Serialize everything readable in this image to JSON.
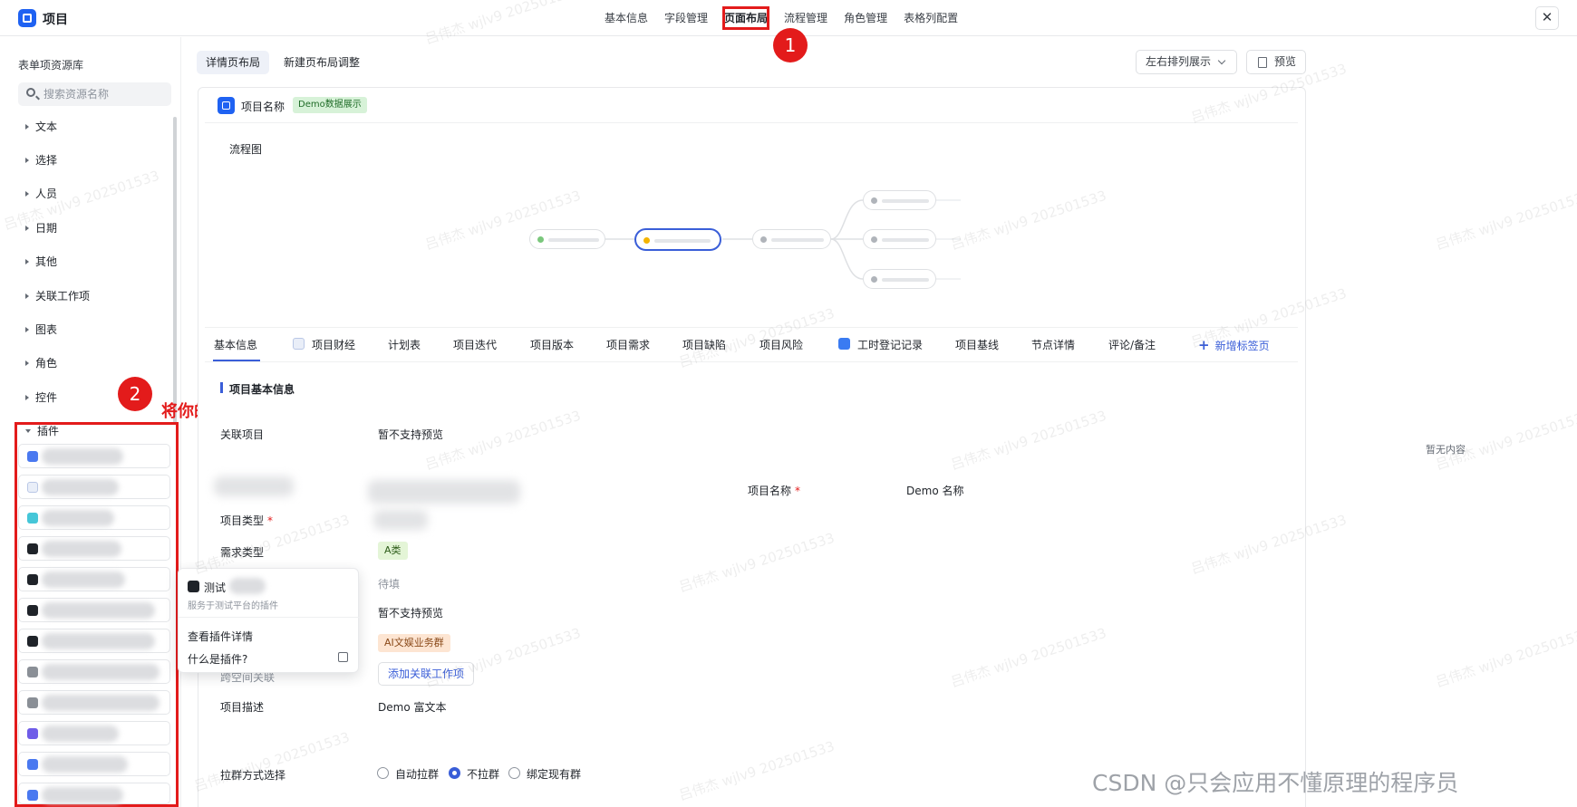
{
  "app": {
    "title": "项目"
  },
  "topnav": {
    "items": [
      "基本信息",
      "字段管理",
      "页面布局",
      "流程管理",
      "角色管理",
      "表格列配置"
    ],
    "active": "页面布局"
  },
  "annotations": {
    "badge1": "1",
    "badge2": "2",
    "instruction": "将你的插件拖动到页面"
  },
  "sidebar": {
    "title": "表单项资源库",
    "search_placeholder": "搜索资源名称",
    "categories": [
      "文本",
      "选择",
      "人员",
      "日期",
      "其他",
      "关联工作项",
      "图表",
      "角色",
      "控件",
      "插件"
    ]
  },
  "popover": {
    "plugin_name": "测试",
    "plugin_desc": "服务于测试平台的插件",
    "view_detail": "查看插件详情",
    "what_is_plugin": "什么是插件?"
  },
  "page_tabs": [
    "详情页布局",
    "新建页布局调整"
  ],
  "toolbar": {
    "arrange_label": "左右排列展示",
    "preview_label": "预览"
  },
  "card": {
    "title": "项目名称",
    "tag": "Demo数据展示",
    "flow_title": "流程图"
  },
  "detail_tabs": [
    "基本信息",
    "项目财经",
    "计划表",
    "项目迭代",
    "项目版本",
    "项目需求",
    "项目缺陷",
    "项目风险",
    "工时登记记录",
    "项目基线",
    "节点详情",
    "评论/备注"
  ],
  "add_tab_label": "新增标签页",
  "section": {
    "title": "项目基本信息"
  },
  "fields": {
    "related_project_label": "关联项目",
    "related_project_value": "暂不支持预览",
    "project_name_label": "项目名称",
    "project_name_value": "Demo 名称",
    "project_type_label": "项目类型",
    "demand_type_label": "需求类型",
    "demand_type_value": "A类",
    "pending_value": "待填",
    "preview_unsupported": "暂不支持预览",
    "group_tag": "AI文娱业务群",
    "cross_space_label": "跨空间关联",
    "add_related_button": "添加关联工作项",
    "description_label": "项目描述",
    "description_value": "Demo 富文本",
    "group_method_label": "拉群方式选择",
    "radio_options": [
      "自动拉群",
      "不拉群",
      "绑定现有群"
    ],
    "radio_selected": "不拉群"
  },
  "right_panel": {
    "empty_text": "暂无内容"
  },
  "watermark": "吕伟杰 wjlv9 202501533",
  "footer_credit": "CSDN @只会应用不懂原理的程序员",
  "colors": {
    "accent": "#3a5ed8",
    "brand": "#1f62f2",
    "annotation_red": "#e31b1b"
  }
}
